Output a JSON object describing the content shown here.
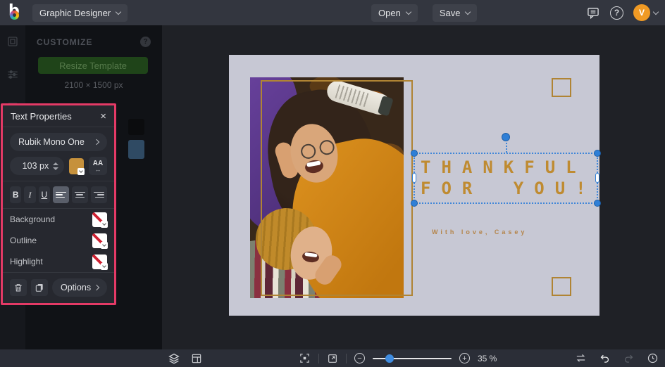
{
  "topbar": {
    "app_name": "Graphic Designer",
    "open_label": "Open",
    "save_label": "Save",
    "avatar_initial": "V",
    "help_glyph": "?"
  },
  "customize_panel": {
    "title": "CUSTOMIZE",
    "help_glyph": "?",
    "resize_button_label": "Resize Template",
    "template_dimensions": "2100 × 1500 px",
    "visible_swatch_colors": [
      "#0b0c0e",
      "#2f4a63"
    ]
  },
  "text_properties": {
    "panel_title": "Text Properties",
    "close_glyph": "×",
    "font_name": "Rubik Mono One",
    "font_size": "103 px",
    "text_color_swatch": "#c6913c",
    "case_label": "AA",
    "case_arrow": "↔",
    "bold_label": "B",
    "italic_label": "I",
    "underline_label": "U",
    "background_label": "Background",
    "outline_label": "Outline",
    "highlight_label": "Highlight",
    "options_label": "Options",
    "accent_border_color": "#e43a66"
  },
  "canvas": {
    "background_color": "#c7c8d4",
    "headline_line1": "THANKFUL",
    "headline_line2": "FOR YOU!",
    "headline_color": "#bf8b31",
    "signature": "With love, Casey",
    "signature_color": "#b5854a",
    "frame_color": "#b08434",
    "selection_color": "#2f7fd6"
  },
  "bottombar": {
    "zoom_level": "35 %",
    "minus_glyph": "−",
    "plus_glyph": "+"
  }
}
